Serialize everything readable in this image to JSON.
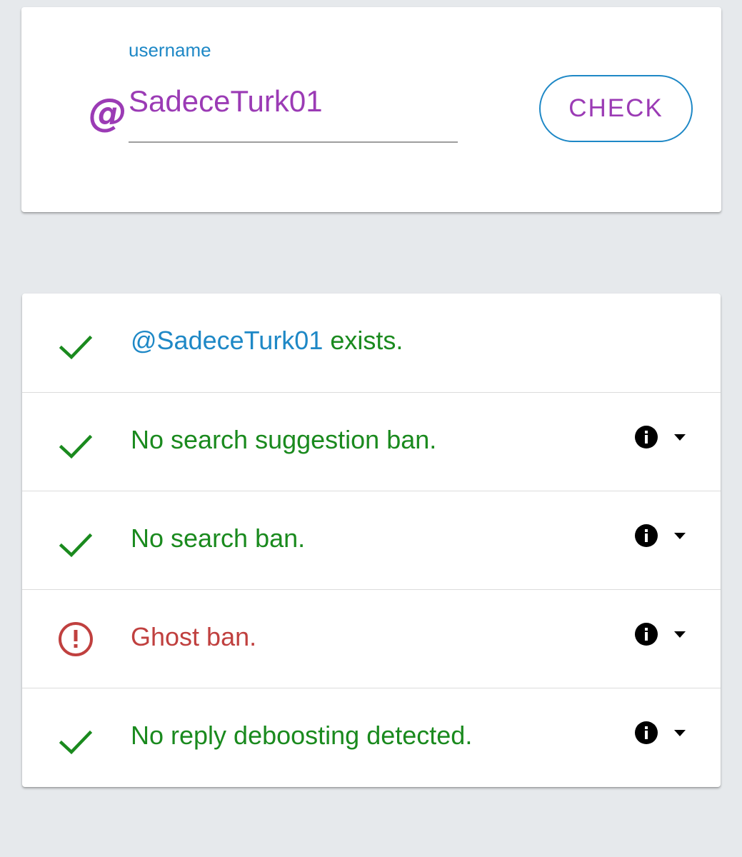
{
  "search": {
    "label": "username",
    "at_symbol": "@",
    "value": "SadeceTurk01",
    "button_label": "CHECK"
  },
  "results": {
    "exists": {
      "handle": "@SadeceTurk01",
      "suffix": " exists.",
      "status": "ok"
    },
    "items": [
      {
        "text": "No search suggestion ban.",
        "status": "ok"
      },
      {
        "text": "No search ban.",
        "status": "ok"
      },
      {
        "text": "Ghost ban.",
        "status": "error"
      },
      {
        "text": "No reply deboosting detected.",
        "status": "ok"
      }
    ]
  },
  "icons": {
    "ok": "check-icon",
    "error": "alert-circle-icon",
    "info": "info-icon",
    "expand": "caret-down-icon"
  },
  "colors": {
    "accent_purple": "#9b3bb5",
    "accent_blue": "#1e88c6",
    "ok_green": "#1a8a1e",
    "error_red": "#c0403f",
    "background": "#e6e9ec"
  }
}
